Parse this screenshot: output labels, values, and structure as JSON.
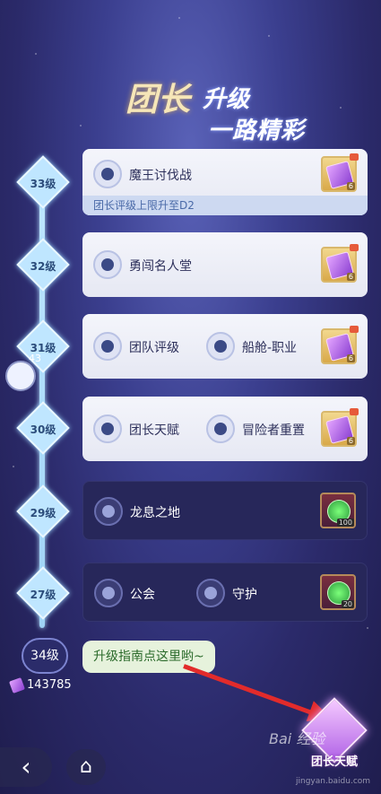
{
  "title": {
    "line1": "团长",
    "line1b": "升级",
    "line2": "一路精彩"
  },
  "levels": [
    {
      "label": "33级",
      "features": [
        "魔王讨伐战"
      ],
      "strip": "团长评级上限升至D2",
      "reward_count": "6",
      "style": "light"
    },
    {
      "label": "32级",
      "features": [
        "勇闯名人堂"
      ],
      "reward_count": "6",
      "style": "light"
    },
    {
      "label": "31级",
      "features": [
        "团队评级",
        "船舱-职业"
      ],
      "reward_count": "6",
      "style": "light"
    },
    {
      "label": "30级",
      "features": [
        "团长天赋",
        "冒险者重置"
      ],
      "reward_count": "6",
      "style": "light"
    },
    {
      "label": "29级",
      "features": [
        "龙息之地"
      ],
      "reward_count": "100",
      "style": "dark"
    },
    {
      "label": "27级",
      "features": [
        "公会",
        "守护"
      ],
      "reward_count": "20",
      "style": "dark"
    }
  ],
  "side_float": {
    "count": "43"
  },
  "current_level": "34级",
  "guide_text": "升级指南点这里哟~",
  "gem_count": "143785",
  "talent_button_label": "团长天赋",
  "watermark": {
    "main": "Bai 经验",
    "sub": "jingyan.baidu.com"
  },
  "icons": {
    "back": "back-arrow-icon",
    "home": "home-icon"
  }
}
